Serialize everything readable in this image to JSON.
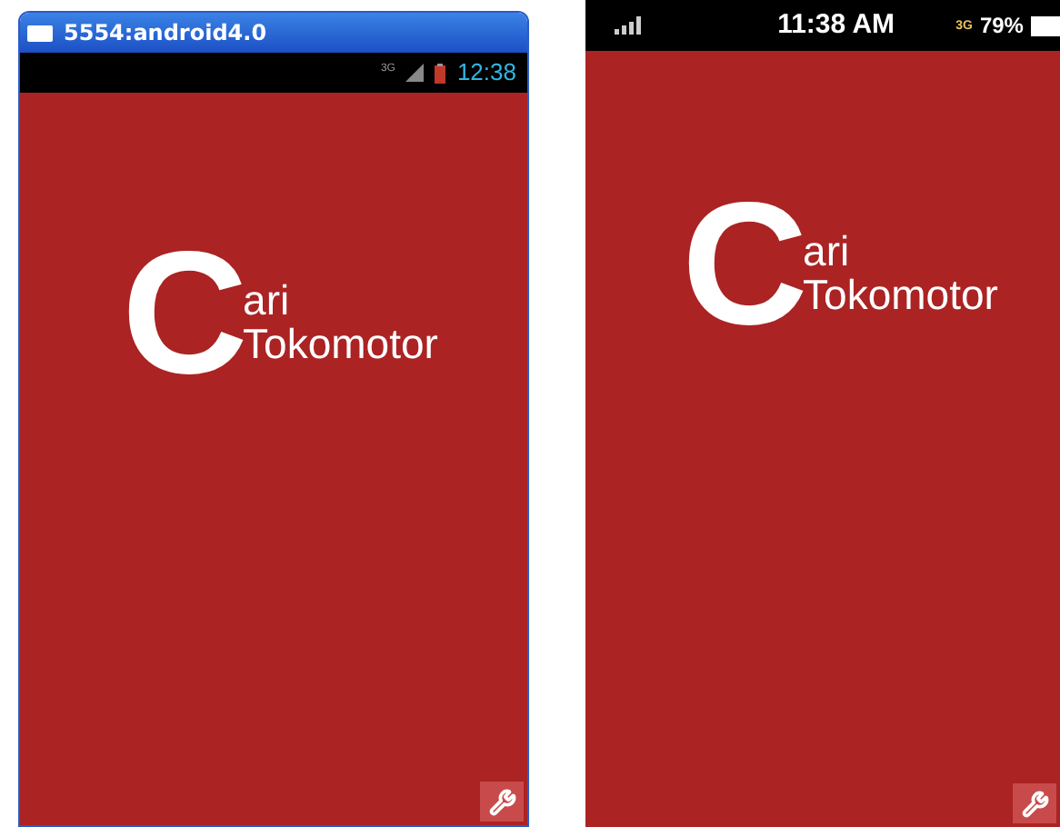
{
  "screens": [
    {
      "kind": "emulator",
      "window_title": "5554:android4.0",
      "status_bar": {
        "network": "3G",
        "time": "12:38"
      },
      "logo": {
        "initial": "C",
        "line_1": "ari",
        "line_2": "Tokomotor"
      }
    },
    {
      "kind": "device",
      "status_bar": {
        "time": "11:38 AM",
        "network": "3G",
        "battery": "79%"
      },
      "logo": {
        "initial": "C",
        "line_1": "ari",
        "line_2": "Tokomotor"
      }
    }
  ]
}
